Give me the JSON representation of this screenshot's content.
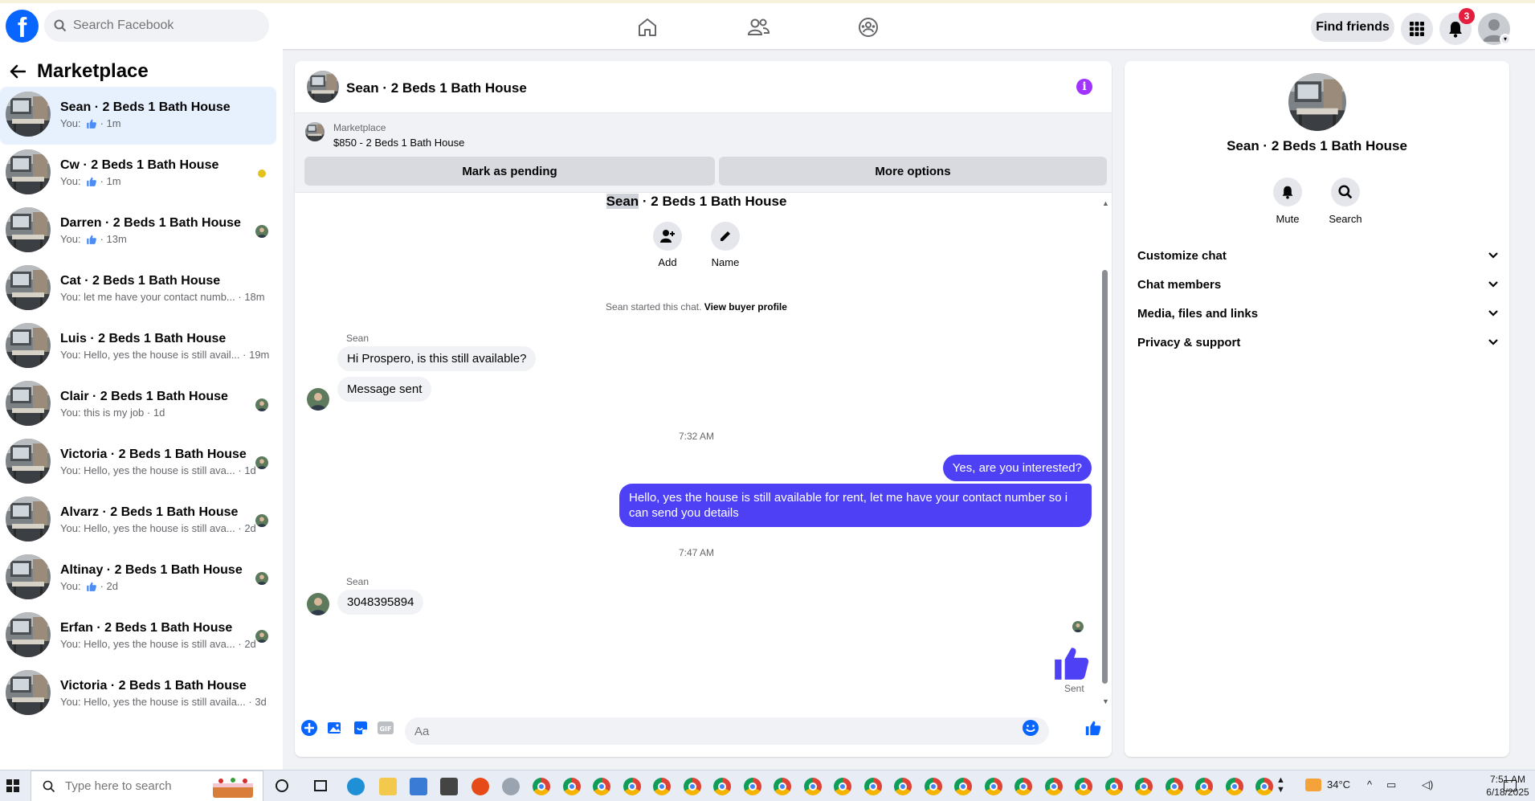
{
  "topbar": {
    "logo": "f",
    "search_placeholder": "Search Facebook",
    "find_friends": "Find friends",
    "notification_count": "3"
  },
  "left": {
    "title": "Marketplace",
    "chats": [
      {
        "name": "Sean · 2 Beds 1 Bath House",
        "preview": "You:",
        "liked": true,
        "time": "· 1m",
        "active": true
      },
      {
        "name": "Cw · 2 Beds 1 Bath House",
        "preview": "You:",
        "liked": true,
        "time": "· 1m",
        "side": "dot"
      },
      {
        "name": "Darren · 2 Beds 1 Bath House",
        "preview": "You:",
        "liked": true,
        "time": "· 13m",
        "side": "avatar"
      },
      {
        "name": "Cat · 2 Beds 1 Bath House",
        "preview": "You: let me have your contact numb...",
        "time": "· 18m"
      },
      {
        "name": "Luis · 2 Beds 1 Bath House",
        "preview": "You: Hello, yes the house is still avail...",
        "time": "· 19m"
      },
      {
        "name": "Clair · 2 Beds 1 Bath House",
        "preview": "You: this is my job",
        "time": "· 1d",
        "side": "avatar"
      },
      {
        "name": "Victoria · 2 Beds 1 Bath House",
        "preview": "You: Hello, yes the house is still ava...",
        "time": "· 1d",
        "side": "avatar"
      },
      {
        "name": "Alvarz · 2 Beds 1 Bath House",
        "preview": "You: Hello, yes the house is still ava...",
        "time": "· 2d",
        "side": "avatar"
      },
      {
        "name": "Altinay · 2 Beds 1 Bath House",
        "preview": "You:",
        "liked": true,
        "time": "· 2d",
        "side": "avatar"
      },
      {
        "name": "Erfan · 2 Beds 1 Bath House",
        "preview": "You: Hello, yes the house is still ava...",
        "time": "· 2d",
        "side": "avatar"
      },
      {
        "name": "Victoria · 2 Beds 1 Bath House",
        "preview": "You: Hello, yes the house is still availa...",
        "time": "· 3d"
      }
    ]
  },
  "conversation": {
    "title": "Sean · 2 Beds 1 Bath House",
    "marketplace_label": "Marketplace",
    "listing": "$850 - 2 Beds 1 Bath House",
    "mark_pending": "Mark as pending",
    "more_options": "More options",
    "intro_name_highlight": "Sean",
    "intro_name_rest": " · 2 Beds 1 Bath House",
    "add_label": "Add",
    "name_label": "Name",
    "started_text": "Sean started this chat. ",
    "view_buyer_profile": "View buyer profile",
    "sender_1": "Sean",
    "msg_1": "Hi Prospero, is this still available?",
    "msg_2": "Message sent",
    "time_1": "7:32 AM",
    "out_1": "Yes, are you interested?",
    "out_2": "Hello, yes the house is still available for rent, let me have your contact number so i can send you details",
    "time_2": "7:47 AM",
    "sender_2": "Sean",
    "msg_3": "3048395894",
    "sent_label": "Sent",
    "composer_placeholder": "Aa"
  },
  "details": {
    "name": "Sean · 2 Beds 1 Bath House",
    "mute": "Mute",
    "search": "Search",
    "sections": [
      "Customize chat",
      "Chat members",
      "Media, files and links",
      "Privacy & support"
    ]
  },
  "taskbar": {
    "search_placeholder": "Type here to search",
    "temperature": "34°C",
    "time": "7:51 AM",
    "date": "6/18/2025"
  },
  "colors": {
    "brand": "#0866ff",
    "outgoing_bubble": "#4e40f5",
    "like": "#4e40f5",
    "badge": "#e41e3f"
  }
}
